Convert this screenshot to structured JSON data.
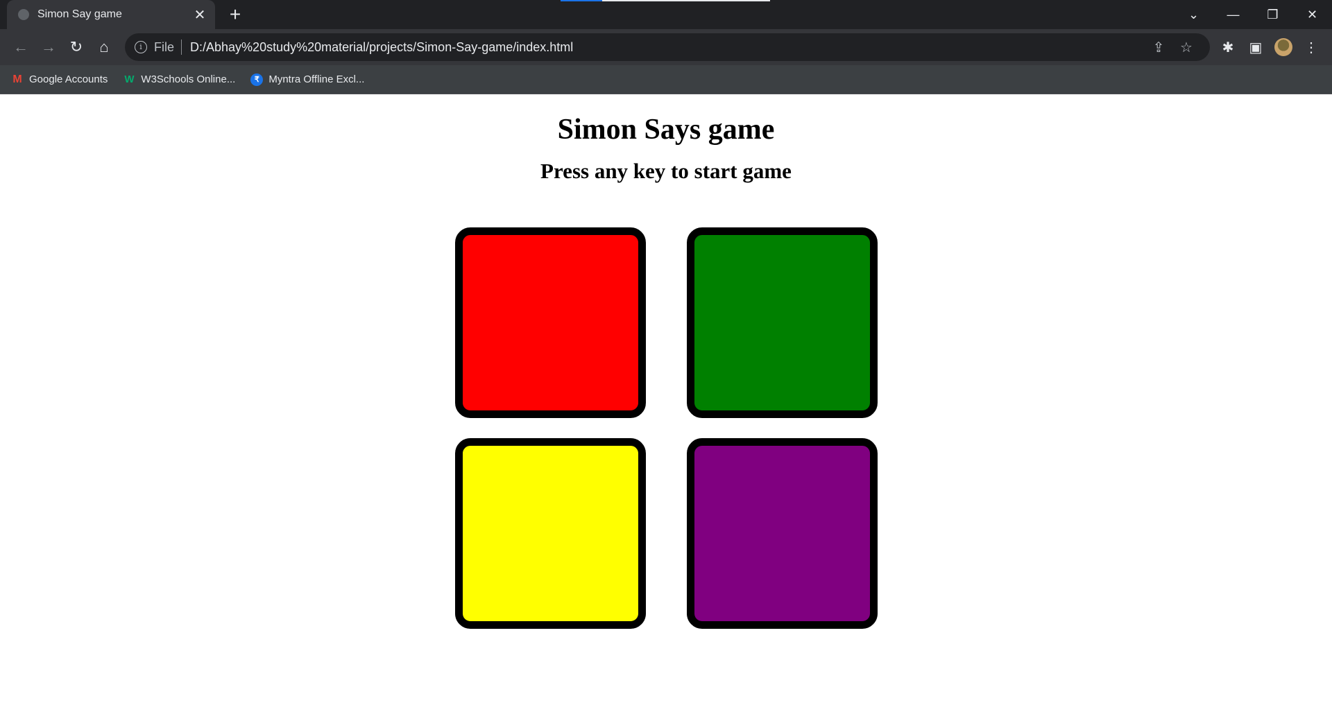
{
  "browser": {
    "tab": {
      "title": "Simon Say game"
    },
    "address": {
      "scheme_label": "File",
      "url": "D:/Abhay%20study%20material/projects/Simon-Say-game/index.html"
    },
    "bookmarks": [
      {
        "label": "Google Accounts",
        "icon": "gmail-icon"
      },
      {
        "label": "W3Schools Online...",
        "icon": "w3schools-icon"
      },
      {
        "label": "Myntra Offline Excl...",
        "icon": "rupee-icon"
      }
    ]
  },
  "page": {
    "title": "Simon Says game",
    "status": "Press any key to start game",
    "buttons": [
      {
        "id": "red",
        "color": "#ff0000"
      },
      {
        "id": "green",
        "color": "#008000"
      },
      {
        "id": "yellow",
        "color": "#ffff00"
      },
      {
        "id": "purple",
        "color": "#800080"
      }
    ]
  }
}
